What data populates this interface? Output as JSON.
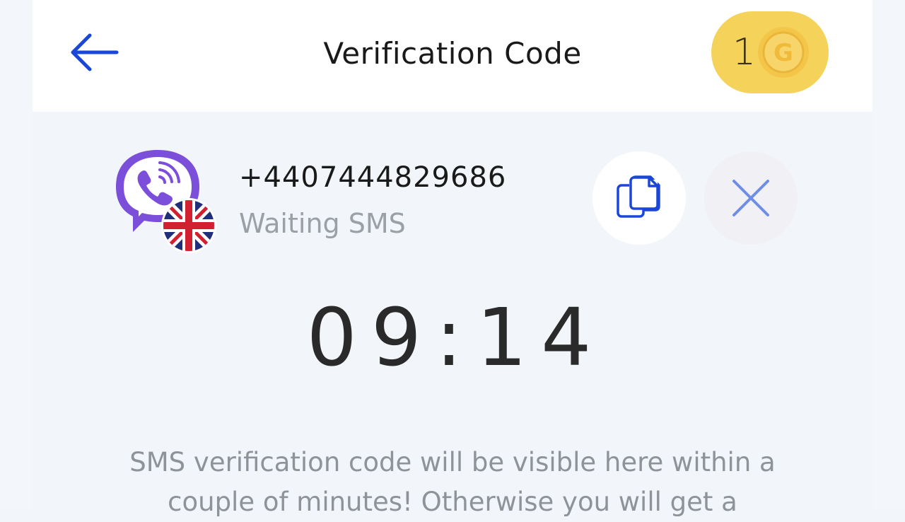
{
  "header": {
    "title": "Verification Code",
    "back_icon": "arrow-left-icon",
    "coin_count": "1",
    "coin_icon": "gold-coin-icon",
    "coin_letter": "G"
  },
  "number_row": {
    "app_icon": "viber-icon",
    "flag_icon": "uk-flag-icon",
    "phone_number": "+4407444829686",
    "status": "Waiting SMS",
    "copy_icon": "copy-icon",
    "cancel_icon": "close-icon"
  },
  "timer": {
    "value": "09:14"
  },
  "info": {
    "message": "SMS verification code will be visible here within a couple of minutes! Otherwise you will get a"
  },
  "colors": {
    "accent_blue": "#1b47d8",
    "viber_purple": "#7b4fd9",
    "coin_yellow": "#f5d35a",
    "background": "#f2f5f9"
  }
}
